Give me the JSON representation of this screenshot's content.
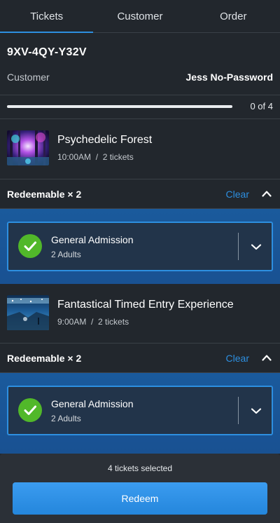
{
  "tabs": [
    {
      "label": "Tickets",
      "active": true
    },
    {
      "label": "Customer",
      "active": false
    },
    {
      "label": "Order",
      "active": false
    }
  ],
  "order": {
    "code": "9XV-4QY-Y32V",
    "customer_label": "Customer",
    "customer_name": "Jess No-Password"
  },
  "progress": {
    "text": "0 of 4",
    "fraction": 0.0
  },
  "events": [
    {
      "title": "Psychedelic Forest",
      "time": "10:00AM",
      "separator": "/",
      "tickets": "2 tickets",
      "redeem_label": "Redeemable × 2",
      "clear_label": "Clear",
      "ticket_type": "General Admission",
      "ticket_detail": "2 Adults"
    },
    {
      "title": "Fantastical Timed Entry Experience",
      "time": "9:00AM",
      "separator": "/",
      "tickets": "2 tickets",
      "redeem_label": "Redeemable × 2",
      "clear_label": "Clear",
      "ticket_type": "General Admission",
      "ticket_detail": "2 Adults"
    }
  ],
  "footer": {
    "selected_text": "4 tickets selected",
    "redeem_label": "Redeem"
  },
  "colors": {
    "accent": "#2d8fe0",
    "background": "#22272d",
    "selection_zone": "#1a5a9c",
    "check": "#51b82a"
  },
  "icons": {
    "collapse": "chevron-up-icon",
    "expand": "chevron-down-icon",
    "selected": "check-circle-icon"
  }
}
